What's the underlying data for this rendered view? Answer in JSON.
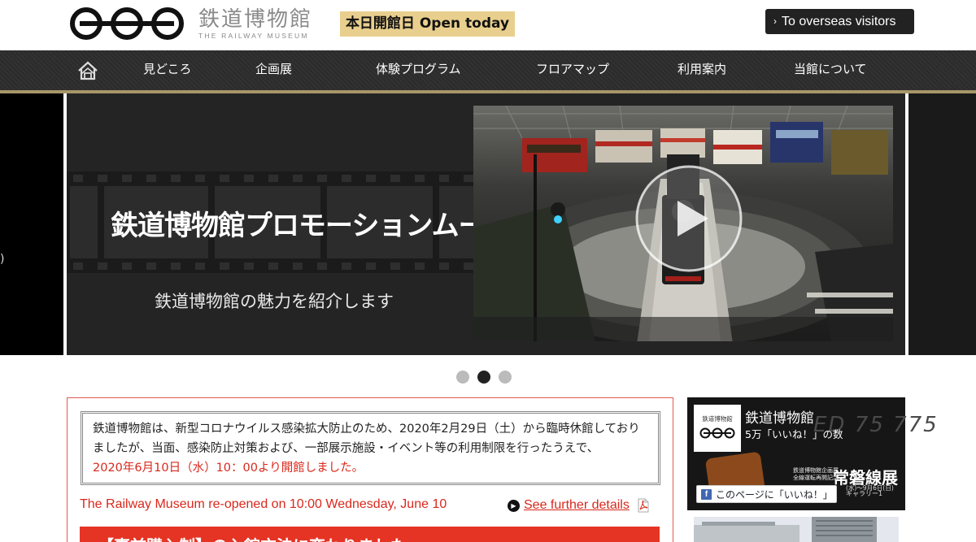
{
  "header": {
    "logo_jp": "鉄道博物館",
    "logo_en": "THE RAILWAY MUSEUM",
    "open_badge": "本日開館日 Open today",
    "overseas_chevron": "›",
    "overseas_label": "To overseas visitors"
  },
  "nav": {
    "home_icon": "home-icon",
    "items": [
      "見どころ",
      "企画展",
      "体験プログラム",
      "フロアマップ",
      "利用案内",
      "当館について"
    ]
  },
  "slider": {
    "left_peek": ")",
    "promo_title": "鉄道博物館プロモーションムービー",
    "promo_subtitle": "鉄道博物館の魅力を紹介します",
    "active_dot": 2,
    "dot_count": 3
  },
  "notice": {
    "jp_text": "鉄道博物館は、新型コロナウイルス感染拡大防止のため、2020年2月29日（土）から臨時休館しておりましたが、当面、感染防止対策および、一部展示施設・イベント等の利用制限を行ったうえで、",
    "jp_red": "2020年6月10日（水）10：00より開館しました。",
    "en_text": "The Railway Museum re-opened on 10:00 Wednesday, June 10",
    "further_label": "See further details",
    "red_bar": "【事前購入制】の入館方法に変わりました"
  },
  "facebook": {
    "logo_jp": "鉄道博物館",
    "title": "鉄道博物館",
    "likes": "5万「いいね！」の数",
    "bg_text": "ED 75 775",
    "exh_small_1": "鉄道博物館企画展",
    "exh_small_2": "全線運転再開記念",
    "exh_big": "常磐線展",
    "exh_dates": "(水)～9月6日(日)",
    "like_button": "このページに「いいね！」",
    "gallery": "ギャラリー1"
  },
  "colors": {
    "accent_red": "#d9281c",
    "nav_gold": "#a89668",
    "badge_gold": "#e9cf8e"
  }
}
